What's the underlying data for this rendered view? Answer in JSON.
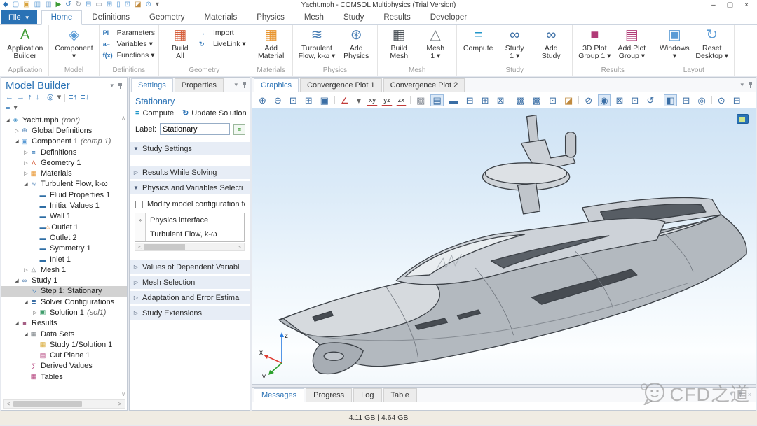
{
  "window": {
    "title": "Yacht.mph - COMSOL Multiphysics (Trial Version)",
    "controls": {
      "minimize": "–",
      "maximize": "▢",
      "close": "×"
    }
  },
  "qat": [
    {
      "n": "comsol-logo-icon",
      "g": "◆",
      "c": "#2a72b5"
    },
    {
      "n": "new-file-icon",
      "g": "▢",
      "c": "#5b9bd5"
    },
    {
      "n": "open-file-icon",
      "g": "▣",
      "c": "#d9a33c"
    },
    {
      "n": "save-icon",
      "g": "▥",
      "c": "#5b9bd5"
    },
    {
      "n": "save-as-icon",
      "g": "▥",
      "c": "#7aa8d5"
    },
    {
      "n": "run-icon",
      "g": "▶",
      "c": "#3f9c35"
    },
    {
      "n": "undo-icon",
      "g": "↺",
      "c": "#2a72b5"
    },
    {
      "n": "redo-icon",
      "g": "↻",
      "c": "#9aa0a6"
    },
    {
      "n": "copy-icon",
      "g": "⊟",
      "c": "#5b9bd5"
    },
    {
      "n": "paste-icon",
      "g": "▭",
      "c": "#8a9099"
    },
    {
      "n": "duplicate-icon",
      "g": "⊞",
      "c": "#5b9bd5"
    },
    {
      "n": "delete-icon",
      "g": "▯",
      "c": "#5b9bd5"
    },
    {
      "n": "select-box-icon",
      "g": "⊡",
      "c": "#5b9bd5"
    },
    {
      "n": "clear-icon",
      "g": "◪",
      "c": "#c08a3e"
    },
    {
      "n": "search-icon",
      "g": "⊙",
      "c": "#5b9bd5"
    },
    {
      "n": "qat-menu-icon",
      "g": "▾",
      "c": "#666666"
    }
  ],
  "menu": {
    "file_label": "File",
    "tabs": [
      {
        "label": "Home",
        "active": true
      },
      {
        "label": "Definitions"
      },
      {
        "label": "Geometry"
      },
      {
        "label": "Materials"
      },
      {
        "label": "Physics"
      },
      {
        "label": "Mesh"
      },
      {
        "label": "Study"
      },
      {
        "label": "Results"
      },
      {
        "label": "Developer"
      }
    ]
  },
  "ribbon": {
    "groups": [
      {
        "label": "Application",
        "items": [
          {
            "kind": "large",
            "icon": "application-builder-icon",
            "glyph": "A",
            "color": "#3f9c35",
            "lines": [
              "Application",
              "Builder"
            ]
          }
        ]
      },
      {
        "label": "Model",
        "items": [
          {
            "kind": "large",
            "icon": "component-icon",
            "glyph": "◈",
            "color": "#5b9bd5",
            "lines": [
              "Component",
              "▾"
            ]
          }
        ]
      },
      {
        "label": "Definitions",
        "items": [
          {
            "kind": "stack",
            "rows": [
              {
                "icon": "parameters-icon",
                "pre": "Pi",
                "label": "Parameters"
              },
              {
                "icon": "variables-icon",
                "pre": "a=",
                "label": "Variables ▾"
              },
              {
                "icon": "functions-icon",
                "pre": "f(x)",
                "label": "Functions ▾"
              }
            ]
          }
        ]
      },
      {
        "label": "Geometry",
        "items": [
          {
            "kind": "large",
            "icon": "build-all-icon",
            "glyph": "▦",
            "color": "#d65f3c",
            "lines": [
              "Build",
              "All"
            ]
          },
          {
            "kind": "stack",
            "rows": [
              {
                "icon": "import-icon",
                "pre": "→",
                "label": "Import"
              },
              {
                "icon": "livelink-icon",
                "pre": "↻",
                "label": "LiveLink ▾"
              }
            ]
          }
        ]
      },
      {
        "label": "Materials",
        "items": [
          {
            "kind": "large",
            "icon": "add-material-icon",
            "glyph": "▦",
            "color": "#e8942d",
            "lines": [
              "Add",
              "Material"
            ]
          }
        ]
      },
      {
        "label": "Physics",
        "items": [
          {
            "kind": "large",
            "icon": "turbulent-flow-ribbon-icon",
            "glyph": "≋",
            "color": "#4a7fb5",
            "lines": [
              "Turbulent",
              "Flow, k-ω ▾"
            ]
          },
          {
            "kind": "large",
            "icon": "add-physics-icon",
            "glyph": "⊛",
            "color": "#4a7fb5",
            "lines": [
              "Add",
              "Physics"
            ]
          }
        ]
      },
      {
        "label": "Mesh",
        "items": [
          {
            "kind": "large",
            "icon": "build-mesh-icon",
            "glyph": "▦",
            "color": "#4d5359",
            "lines": [
              "Build",
              "Mesh"
            ]
          },
          {
            "kind": "large",
            "icon": "mesh-1-icon",
            "glyph": "△",
            "color": "#7a8085",
            "lines": [
              "Mesh",
              "1 ▾"
            ]
          }
        ]
      },
      {
        "label": "Study",
        "items": [
          {
            "kind": "large",
            "icon": "compute-icon",
            "glyph": "=",
            "color": "#2196c9",
            "lines": [
              "Compute",
              ""
            ]
          },
          {
            "kind": "large",
            "icon": "study-1-icon",
            "glyph": "∞",
            "color": "#3a6ea5",
            "lines": [
              "Study",
              "1 ▾"
            ]
          },
          {
            "kind": "large",
            "icon": "add-study-icon",
            "glyph": "∞",
            "color": "#3a6ea5",
            "lines": [
              "Add",
              "Study"
            ]
          }
        ]
      },
      {
        "label": "Results",
        "items": [
          {
            "kind": "large",
            "icon": "plot-group-1-icon",
            "glyph": "■",
            "color": "#b13a77",
            "lines": [
              "3D Plot",
              "Group 1 ▾"
            ]
          },
          {
            "kind": "large",
            "icon": "add-plot-group-icon",
            "glyph": "▤",
            "color": "#b13a77",
            "lines": [
              "Add Plot",
              "Group ▾"
            ]
          }
        ]
      },
      {
        "label": "Layout",
        "items": [
          {
            "kind": "large",
            "icon": "windows-icon",
            "glyph": "▣",
            "color": "#5b9bd5",
            "lines": [
              "Windows",
              "▾"
            ]
          },
          {
            "kind": "large",
            "icon": "reset-desktop-icon",
            "glyph": "↻",
            "color": "#5b9bd5",
            "lines": [
              "Reset",
              "Desktop ▾"
            ]
          }
        ]
      }
    ]
  },
  "model_builder": {
    "title": "Model Builder",
    "toolbar_row1": [
      {
        "n": "nav-back-icon",
        "g": "←"
      },
      {
        "n": "nav-forward-icon",
        "g": "→"
      },
      {
        "n": "move-up-icon",
        "g": "↑"
      },
      {
        "n": "move-down-icon",
        "g": "↓"
      },
      {
        "sep": true
      },
      {
        "n": "show-icon",
        "g": "◎"
      },
      {
        "n": "show-menu-icon",
        "g": "▾",
        "c": "#666666"
      },
      {
        "sep": true
      },
      {
        "n": "collapse-all-icon",
        "g": "≡↑"
      },
      {
        "n": "expand-all-icon",
        "g": "≡↓"
      }
    ],
    "toolbar_row2": [
      {
        "n": "model-tree-node-menu-icon",
        "g": "≡"
      },
      {
        "n": "node-menu-arrow-icon",
        "g": "▾",
        "c": "#666666"
      }
    ],
    "icon_styles": {
      "model-root-icon": {
        "g": "◈",
        "c": "#2e86c1"
      },
      "global-definitions-icon": {
        "g": "⊕",
        "c": "#4a7fb5"
      },
      "component-icon": {
        "g": "▣",
        "c": "#5b9bd5"
      },
      "definitions-icon": {
        "g": "≡",
        "c": "#2a72b5"
      },
      "geometry-icon": {
        "g": "Λ",
        "c": "#d65f3c"
      },
      "materials-icon": {
        "g": "▦",
        "c": "#e8942d"
      },
      "turbulent-flow-icon": {
        "g": "≋",
        "c": "#4a7fb5"
      },
      "domain-node-icon": {
        "g": "▬",
        "c": "#2e6da4"
      },
      "boundary-node-icon": {
        "g": "▬",
        "c": "#2e6da4"
      },
      "boundary-warning-icon": {
        "g": "▬",
        "c": "#2e6da4"
      },
      "mesh-icon": {
        "g": "△",
        "c": "#7a8085"
      },
      "study-icon": {
        "g": "∞",
        "c": "#3a6ea5"
      },
      "stationary-step-icon": {
        "g": "∿",
        "c": "#2a72b5"
      },
      "solver-config-icon": {
        "g": "≣",
        "c": "#3a6ea5"
      },
      "solution-icon": {
        "g": "▣",
        "c": "#3f9c6b"
      },
      "results-icon": {
        "g": "■",
        "c": "#a55f85"
      },
      "data-sets-icon": {
        "g": "▦",
        "c": "#7a8085"
      },
      "study-solution-icon": {
        "g": "▦",
        "c": "#d6a429"
      },
      "cut-plane-icon": {
        "g": "▤",
        "c": "#b13a77"
      },
      "derived-values-icon": {
        "g": "∑",
        "c": "#b13a77"
      },
      "tables-icon": {
        "g": "▦",
        "c": "#b13a77"
      }
    },
    "tree": [
      {
        "label": "Yacht.mph",
        "suffix": "(root)",
        "level": 0,
        "arrow": "open",
        "icon": "model-root-icon"
      },
      {
        "label": "Global Definitions",
        "level": 1,
        "arrow": "closed",
        "icon": "global-definitions-icon"
      },
      {
        "label": "Component 1",
        "suffix": "(comp 1)",
        "level": 1,
        "arrow": "open",
        "icon": "component-icon"
      },
      {
        "label": "Definitions",
        "level": 2,
        "arrow": "closed",
        "icon": "definitions-icon"
      },
      {
        "label": "Geometry 1",
        "level": 2,
        "arrow": "closed",
        "icon": "geometry-icon"
      },
      {
        "label": "Materials",
        "level": 2,
        "arrow": "closed",
        "icon": "materials-icon"
      },
      {
        "label": "Turbulent Flow, k-ω",
        "level": 2,
        "arrow": "open",
        "icon": "turbulent-flow-icon"
      },
      {
        "label": "Fluid Properties 1",
        "level": 3,
        "icon": "domain-node-icon"
      },
      {
        "label": "Initial Values 1",
        "level": 3,
        "icon": "domain-node-icon"
      },
      {
        "label": "Wall 1",
        "level": 3,
        "icon": "domain-node-icon"
      },
      {
        "label": "Outlet 1",
        "level": 3,
        "icon": "boundary-warning-icon",
        "warn": true
      },
      {
        "label": "Outlet 2",
        "level": 3,
        "icon": "boundary-node-icon"
      },
      {
        "label": "Symmetry 1",
        "level": 3,
        "icon": "boundary-node-icon"
      },
      {
        "label": "Inlet 1",
        "level": 3,
        "icon": "boundary-node-icon"
      },
      {
        "label": "Mesh 1",
        "level": 2,
        "arrow": "closed",
        "icon": "mesh-icon"
      },
      {
        "label": "Study 1",
        "level": 1,
        "arrow": "open",
        "icon": "study-icon"
      },
      {
        "label": "Step 1: Stationary",
        "level": 2,
        "icon": "stationary-step-icon",
        "selected": true
      },
      {
        "label": "Solver Configurations",
        "level": 2,
        "arrow": "open",
        "icon": "solver-config-icon"
      },
      {
        "label": "Solution 1",
        "suffix": "(sol1)",
        "level": 3,
        "arrow": "closed",
        "icon": "solution-icon"
      },
      {
        "label": "Results",
        "level": 1,
        "arrow": "open",
        "icon": "results-icon"
      },
      {
        "label": "Data Sets",
        "level": 2,
        "arrow": "open",
        "icon": "data-sets-icon"
      },
      {
        "label": "Study 1/Solution 1",
        "level": 3,
        "icon": "study-solution-icon"
      },
      {
        "label": "Cut Plane 1",
        "level": 3,
        "icon": "cut-plane-icon"
      },
      {
        "label": "Derived Values",
        "level": 2,
        "icon": "derived-values-icon"
      },
      {
        "label": "Tables",
        "level": 2,
        "icon": "tables-icon"
      }
    ]
  },
  "settings": {
    "tabs": [
      {
        "label": "Settings",
        "active": true
      },
      {
        "label": "Properties"
      }
    ],
    "node_title": "Stationary",
    "actions": {
      "compute": "Compute",
      "update_solution": "Update Solution"
    },
    "label_caption": "Label:",
    "label_value": "Stationary",
    "sections": [
      {
        "label": "Study Settings",
        "arrow": "▼"
      },
      {
        "label": "Results While Solving",
        "arrow": "▷"
      },
      {
        "label": "Physics and Variables Selecti",
        "arrow": "▼"
      },
      {
        "label": "Values of Dependent Variabl",
        "arrow": "▷"
      },
      {
        "label": "Mesh Selection",
        "arrow": "▷"
      },
      {
        "label": "Adaptation and Error Estima",
        "arrow": "▷"
      },
      {
        "label": "Study Extensions",
        "arrow": "▷"
      }
    ],
    "checkbox_label": "Modify model configuration fo",
    "table": {
      "col0_header": "»",
      "col1_header": "Physics interface",
      "row1": "Turbulent Flow, k-ω"
    }
  },
  "graphics": {
    "tabs": [
      {
        "label": "Graphics",
        "active": true
      },
      {
        "label": "Convergence Plot 1"
      },
      {
        "label": "Convergence Plot 2"
      }
    ],
    "toolbar": [
      {
        "n": "zoom-in-icon",
        "g": "⊕"
      },
      {
        "n": "zoom-out-icon",
        "g": "⊖"
      },
      {
        "n": "zoom-box-icon",
        "g": "⊡"
      },
      {
        "n": "zoom-extents-icon",
        "g": "⊞"
      },
      {
        "n": "zoom-selected-icon",
        "g": "▣"
      },
      {
        "sep": true
      },
      {
        "n": "default-view-icon",
        "g": "∠",
        "c": "#c23b3b"
      },
      {
        "n": "view-menu-icon",
        "g": "▾",
        "c": "#666666"
      },
      {
        "n": "xy-view-icon",
        "g": "xy",
        "text": true
      },
      {
        "n": "yz-view-icon",
        "g": "yz",
        "text": true
      },
      {
        "n": "zx-view-icon",
        "g": "zx",
        "text": true
      },
      {
        "sep": true
      },
      {
        "n": "scene-objects-icon",
        "g": "▩",
        "c": "#8a9099"
      },
      {
        "n": "wireframe-rendering-icon",
        "g": "▤",
        "active": true
      },
      {
        "n": "surface-rendering-icon",
        "g": "▬"
      },
      {
        "n": "hide-faces-icon",
        "g": "⊟"
      },
      {
        "n": "mesh-rendering-icon",
        "g": "⊞"
      },
      {
        "n": "transparency-icon",
        "g": "⊠"
      },
      {
        "sep": true
      },
      {
        "n": "windowed-plot-icon",
        "g": "▩"
      },
      {
        "n": "animation-player-icon",
        "g": "▩"
      },
      {
        "n": "select-region-icon",
        "g": "⊡"
      },
      {
        "n": "deselect-region-icon",
        "g": "◪",
        "c": "#c08a3e"
      },
      {
        "sep": true
      },
      {
        "n": "hide-selected-icon",
        "g": "⊘"
      },
      {
        "n": "view-hidden-icon",
        "g": "◉",
        "active": true
      },
      {
        "n": "show-selection-icon",
        "g": "⊠"
      },
      {
        "n": "select-behind-icon",
        "g": "⊡"
      },
      {
        "n": "reset-hiding-icon",
        "g": "↺"
      },
      {
        "sep": true
      },
      {
        "n": "scene-light-icon",
        "g": "◧",
        "active": true
      },
      {
        "n": "environment-reflections-icon",
        "g": "⊟"
      },
      {
        "n": "view-cube-icon",
        "g": "◎"
      },
      {
        "sep": true
      },
      {
        "n": "image-snapshot-icon",
        "g": "⊙"
      },
      {
        "n": "print-icon",
        "g": "⊟"
      }
    ],
    "axis": {
      "x": "x",
      "y": "y",
      "z": "z"
    }
  },
  "bottom_panel": {
    "tabs": [
      {
        "label": "Messages",
        "active": true
      },
      {
        "label": "Progress"
      },
      {
        "label": "Log"
      },
      {
        "label": "Table"
      }
    ]
  },
  "watermark": {
    "text": "CFD之道"
  },
  "status_bar": {
    "memory": "4.11 GB | 4.64 GB"
  }
}
